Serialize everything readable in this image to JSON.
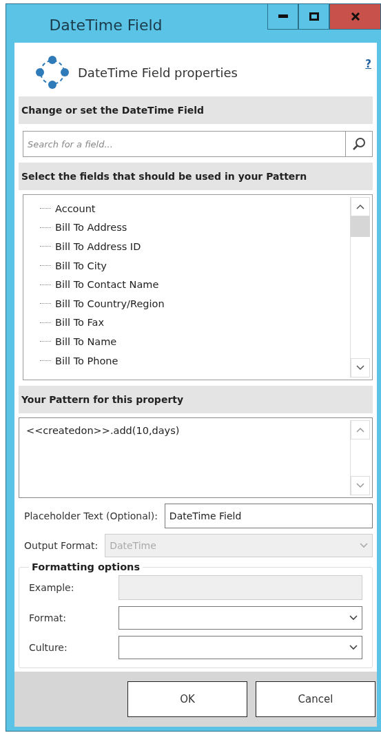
{
  "window": {
    "title": "DateTime Field"
  },
  "header": {
    "title": "DateTime Field properties",
    "help": "?"
  },
  "change_section": {
    "heading": "Change or set the DateTime Field",
    "search": {
      "placeholder": "Search for a field..."
    }
  },
  "fields_section": {
    "heading": "Select the fields that should be used in your Pattern",
    "items": [
      {
        "label": "Account"
      },
      {
        "label": "Bill To Address"
      },
      {
        "label": "Bill To Address ID"
      },
      {
        "label": "Bill To City"
      },
      {
        "label": "Bill To Contact Name"
      },
      {
        "label": "Bill To Country/Region"
      },
      {
        "label": "Bill To Fax"
      },
      {
        "label": "Bill To Name"
      },
      {
        "label": "Bill To Phone"
      }
    ]
  },
  "pattern_section": {
    "heading": "Your Pattern for this property",
    "value": "<<createdon>>.add(10,days)"
  },
  "placeholder_text": {
    "label": "Placeholder Text (Optional):",
    "value": "DateTime Field"
  },
  "output_format": {
    "label": "Output Format:",
    "value": "DateTime",
    "disabled": true
  },
  "formatting_options": {
    "heading": "Formatting options",
    "rows": [
      {
        "kind": "text",
        "label": "Example:",
        "disabled": true
      },
      {
        "kind": "select",
        "label": "Format:",
        "disabled": false
      },
      {
        "kind": "select",
        "label": "Culture:",
        "disabled": false
      }
    ]
  },
  "buttons": [
    {
      "label": "OK"
    },
    {
      "label": "Cancel"
    }
  ]
}
